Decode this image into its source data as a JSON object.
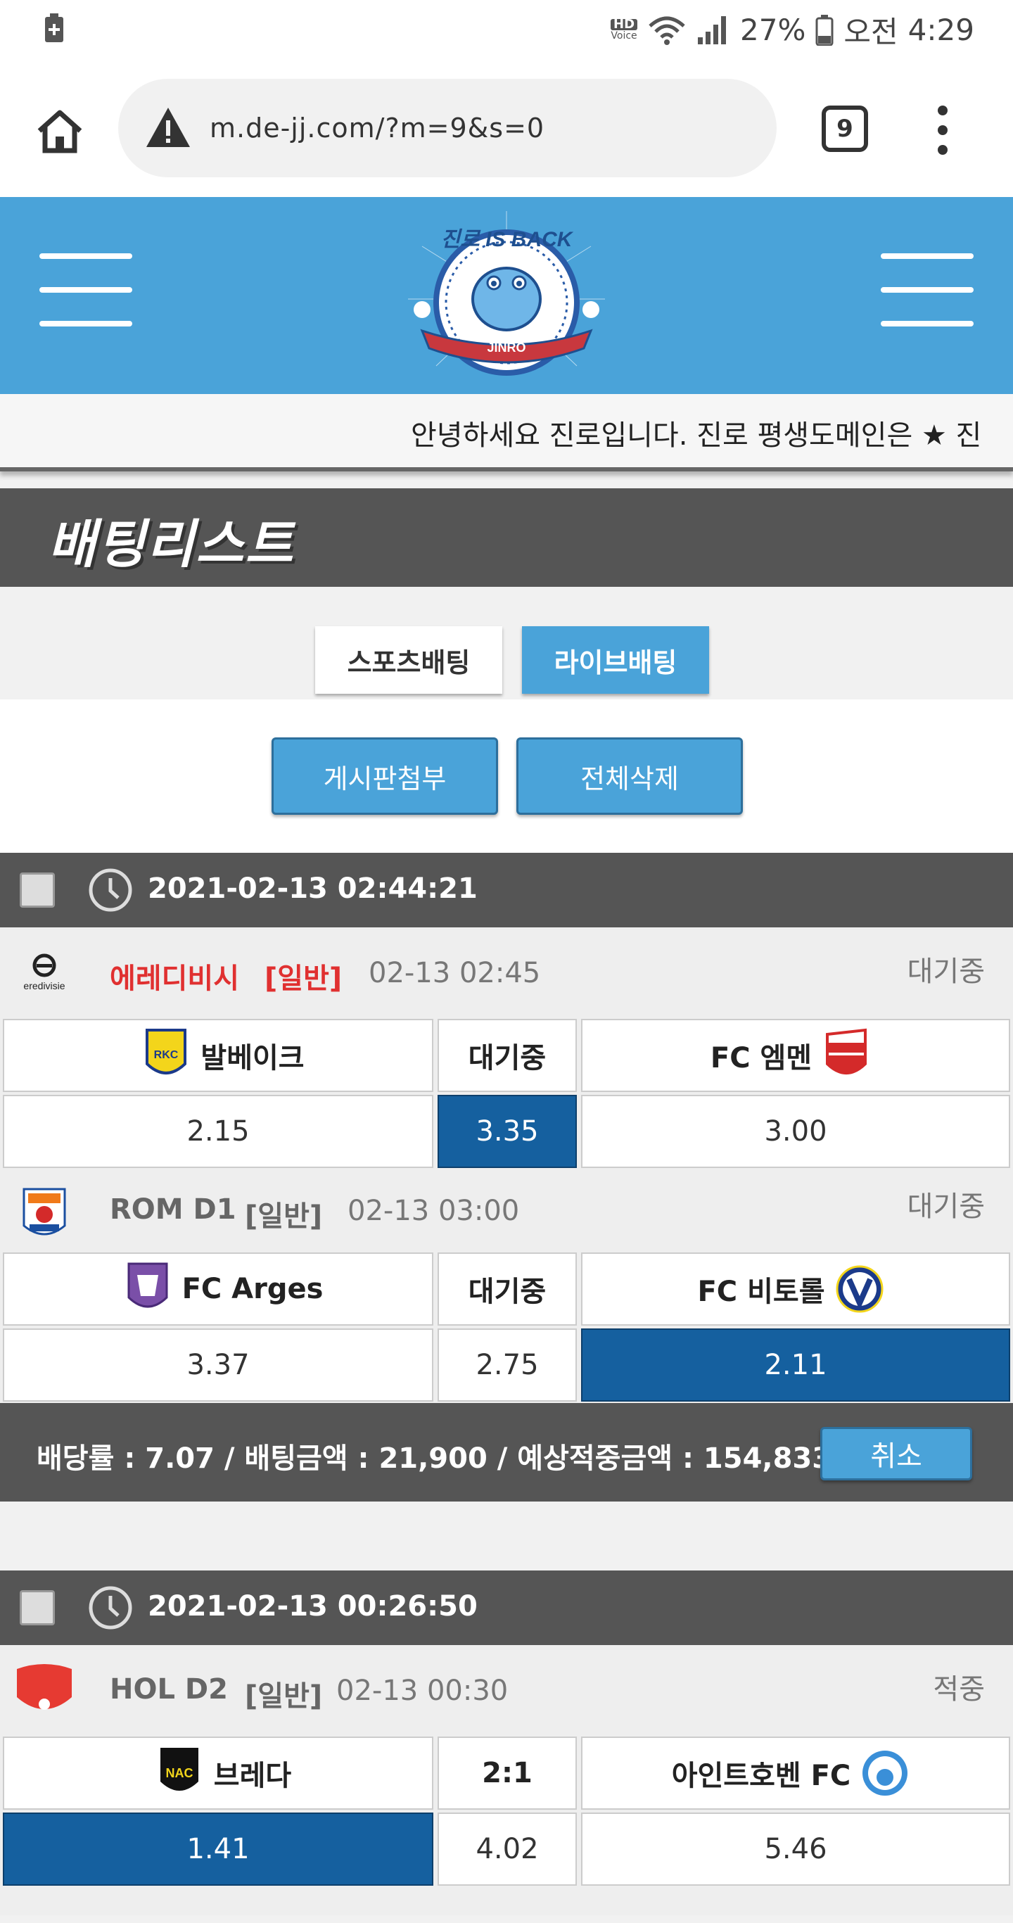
{
  "status_bar": {
    "hd_top": "HD",
    "hd_bottom": "Voice",
    "battery_pct": "27%",
    "ampm": "오전",
    "time": "4:29"
  },
  "browser": {
    "url": "m.de-jj.com/?m=9&s=0",
    "tab_count": "9"
  },
  "header": {
    "logo_top": "진로 IS BACK",
    "logo_band": "JINRO"
  },
  "notice": "안녕하세요 진로입니다. 진로 평생도메인은 ★ 진",
  "page_title": "배팅리스트",
  "tabs": [
    {
      "label": "스포츠배팅"
    },
    {
      "label": "라이브배팅"
    }
  ],
  "actions": {
    "attach": "게시판첨부",
    "delete_all": "전체삭제"
  },
  "bets": [
    {
      "datetime": "2021-02-13 02:44:21",
      "games": [
        {
          "league": "에레디비시",
          "type": "[일반]",
          "time": "02-13 02:45",
          "status": "대기중",
          "home": "발베이크",
          "center": "대기중",
          "away": "FC 엠멘",
          "odds": [
            "2.15",
            "3.35",
            "3.00"
          ]
        },
        {
          "league": "ROM D1",
          "type": "[일반]",
          "time": "02-13 03:00",
          "status": "대기중",
          "home": "FC Arges",
          "center": "대기중",
          "away": "FC 비토롤",
          "odds": [
            "3.37",
            "2.75",
            "2.11"
          ]
        }
      ],
      "summary": "배당률 : 7.07 / 배팅금액 : 21,900 / 예상적중금액 : 154,833",
      "cancel": "취소"
    },
    {
      "datetime": "2021-02-13 00:26:50",
      "games": [
        {
          "league": "HOL D2",
          "type": "[일반]",
          "time": "02-13 00:30",
          "status": "적중",
          "home": "브레다",
          "center": "2:1",
          "away": "아인트호벤 FC",
          "odds": [
            "1.41",
            "4.02",
            "5.46"
          ]
        }
      ]
    }
  ],
  "colors": {
    "header_blue": "#4aa3d9",
    "selected_odds": "#15609f",
    "league_red": "#e03030",
    "dark_bar": "#555555"
  }
}
